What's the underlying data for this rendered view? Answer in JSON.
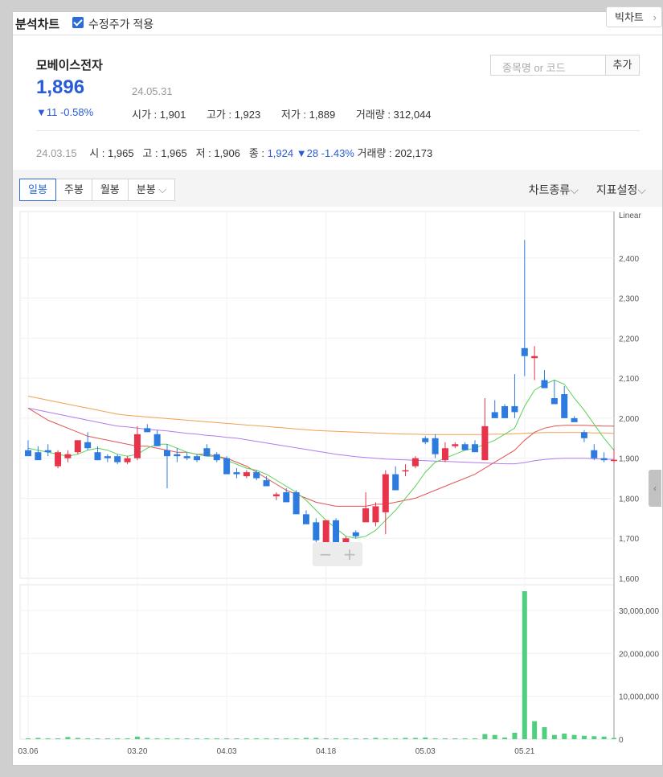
{
  "header": {
    "title": "분석차트",
    "adjusted_label": "수정주가 적용",
    "big_chart_label": "빅차트"
  },
  "stock": {
    "name": "모베이스전자",
    "price": "1,896",
    "date": "24.05.31",
    "change": "▼11 -0.58%",
    "open_label": "시가",
    "open": "1,901",
    "high_label": "고가",
    "high": "1,923",
    "low_label": "저가",
    "low": "1,889",
    "volume_label": "거래량",
    "volume": "312,044"
  },
  "search": {
    "placeholder": "종목명 or 코드",
    "add_label": "추가"
  },
  "prev_day": {
    "date": "24.03.15",
    "open": "시 : 1,965",
    "high": "고 : 1,965",
    "low": "저 : 1,906",
    "close_label": "종 :",
    "close": "1,924",
    "change": "▼28 -1.43%",
    "volume": "거래량 : 202,173"
  },
  "tabs": [
    "일봉",
    "주봉",
    "월봉",
    "분봉"
  ],
  "tools": [
    "차트종류",
    "지표설정"
  ],
  "colors": {
    "up": "#e8344a",
    "down": "#2e7be0",
    "volume": "#4fcf7f",
    "ma5": "#5ad05a",
    "ma20": "#e05555",
    "ma60": "#b07bf0",
    "ma120": "#f0a050",
    "accent": "#2a5bd6"
  },
  "chart_data": {
    "type": "candlestick",
    "scale": "Linear",
    "y_ticks": [
      2400,
      2300,
      2200,
      2100,
      2000,
      1900,
      1800,
      1700,
      1600
    ],
    "volume_ticks": [
      "30,000,000",
      "20,000,000",
      "10,000,000",
      "0"
    ],
    "x_labels": [
      "03.06",
      "03.20",
      "04.03",
      "04.18",
      "05.03",
      "05.21"
    ],
    "x_label_index": [
      0,
      11,
      20,
      30,
      40,
      50
    ],
    "candles": [
      [
        1920,
        1945,
        1910,
        1905
      ],
      [
        1915,
        1930,
        1900,
        1895
      ],
      [
        1920,
        1935,
        1905,
        1915
      ],
      [
        1880,
        1920,
        1875,
        1915
      ],
      [
        1900,
        1920,
        1890,
        1910
      ],
      [
        1915,
        1945,
        1910,
        1945
      ],
      [
        1940,
        1965,
        1920,
        1925
      ],
      [
        1915,
        1930,
        1895,
        1895
      ],
      [
        1905,
        1910,
        1890,
        1900
      ],
      [
        1905,
        1910,
        1885,
        1890
      ],
      [
        1890,
        1905,
        1885,
        1900
      ],
      [
        1900,
        1980,
        1895,
        1960
      ],
      [
        1975,
        1985,
        1965,
        1965
      ],
      [
        1960,
        1970,
        1940,
        1930
      ],
      [
        1920,
        1935,
        1825,
        1905
      ],
      [
        1910,
        1925,
        1890,
        1905
      ],
      [
        1905,
        1915,
        1895,
        1900
      ],
      [
        1905,
        1910,
        1890,
        1895
      ],
      [
        1925,
        1935,
        1910,
        1905
      ],
      [
        1910,
        1915,
        1890,
        1895
      ],
      [
        1900,
        1905,
        1860,
        1860
      ],
      [
        1865,
        1875,
        1850,
        1860
      ],
      [
        1855,
        1870,
        1850,
        1865
      ],
      [
        1865,
        1870,
        1845,
        1850
      ],
      [
        1845,
        1855,
        1830,
        1830
      ],
      [
        1805,
        1815,
        1795,
        1810
      ],
      [
        1815,
        1825,
        1795,
        1790
      ],
      [
        1815,
        1820,
        1780,
        1760
      ],
      [
        1760,
        1770,
        1740,
        1735
      ],
      [
        1740,
        1750,
        1690,
        1695
      ],
      [
        1690,
        1745,
        1690,
        1745
      ],
      [
        1745,
        1750,
        1685,
        1680
      ],
      [
        1690,
        1705,
        1680,
        1700
      ],
      [
        1715,
        1720,
        1700,
        1705
      ],
      [
        1740,
        1815,
        1740,
        1775
      ],
      [
        1740,
        1790,
        1730,
        1780
      ],
      [
        1765,
        1870,
        1710,
        1860
      ],
      [
        1860,
        1880,
        1850,
        1820
      ],
      [
        1870,
        1885,
        1855,
        1870
      ],
      [
        1880,
        1905,
        1875,
        1900
      ],
      [
        1950,
        1955,
        1935,
        1940
      ],
      [
        1950,
        1960,
        1900,
        1910
      ],
      [
        1895,
        1940,
        1890,
        1925
      ],
      [
        1930,
        1940,
        1925,
        1935
      ],
      [
        1935,
        1940,
        1920,
        1920
      ],
      [
        1935,
        1945,
        1920,
        1915
      ],
      [
        1895,
        2050,
        1895,
        1980
      ],
      [
        2015,
        2045,
        2005,
        2000
      ],
      [
        2030,
        2035,
        2005,
        2000
      ],
      [
        2030,
        2110,
        2000,
        2015
      ],
      [
        2175,
        2445,
        2105,
        2155
      ],
      [
        2150,
        2180,
        2095,
        2155
      ],
      [
        2095,
        2120,
        2075,
        2075
      ],
      [
        2050,
        2095,
        2040,
        2035
      ],
      [
        2060,
        2080,
        2000,
        2000
      ],
      [
        2000,
        2005,
        1995,
        1990
      ],
      [
        1965,
        1970,
        1940,
        1950
      ],
      [
        1920,
        1935,
        1895,
        1900
      ],
      [
        1900,
        1915,
        1890,
        1895
      ],
      [
        1896,
        1923,
        1889,
        1896
      ]
    ],
    "volume": [
      0.2,
      0.3,
      0.2,
      0.2,
      0.5,
      0.3,
      0.2,
      0.2,
      0.2,
      0.2,
      0.2,
      0.6,
      0.3,
      0.2,
      0.2,
      0.2,
      0.2,
      0.2,
      0.2,
      0.2,
      0.2,
      0.2,
      0.2,
      0.2,
      0.2,
      0.2,
      0.2,
      0.2,
      0.3,
      0.3,
      0.2,
      0.2,
      0.2,
      0.2,
      0.2,
      0.3,
      0.2,
      0.2,
      0.3,
      0.3,
      0.4,
      0.2,
      0.2,
      0.2,
      0.2,
      0.2,
      1.2,
      1.0,
      0.4,
      1.5,
      34.5,
      4.2,
      2.8,
      1.0,
      1.3,
      1.0,
      0.8,
      0.7,
      0.6,
      0.3
    ],
    "ma5": [
      1925,
      1920,
      1915,
      1910,
      1905,
      1910,
      1920,
      1925,
      1920,
      1910,
      1905,
      1910,
      1925,
      1935,
      1935,
      1925,
      1915,
      1910,
      1905,
      1905,
      1895,
      1885,
      1875,
      1870,
      1860,
      1845,
      1830,
      1815,
      1795,
      1770,
      1745,
      1725,
      1705,
      1700,
      1705,
      1720,
      1745,
      1770,
      1800,
      1830,
      1865,
      1890,
      1900,
      1910,
      1920,
      1925,
      1935,
      1945,
      1960,
      1975,
      2030,
      2070,
      2085,
      2095,
      2085,
      2050,
      2020,
      1985,
      1950,
      1920
    ],
    "ma20": [
      2025,
      2010,
      1995,
      1985,
      1975,
      1965,
      1955,
      1950,
      1945,
      1940,
      1935,
      1930,
      1930,
      1925,
      1920,
      1915,
      1915,
      1910,
      1910,
      1905,
      1900,
      1890,
      1880,
      1865,
      1850,
      1835,
      1820,
      1810,
      1800,
      1790,
      1785,
      1780,
      1780,
      1780,
      1780,
      1785,
      1785,
      1790,
      1795,
      1800,
      1810,
      1820,
      1830,
      1840,
      1850,
      1860,
      1875,
      1890,
      1905,
      1920,
      1945,
      1965,
      1975,
      1980,
      1982,
      1982,
      1982,
      1981,
      1980,
      1980
    ],
    "ma60": [
      2025,
      2020,
      2015,
      2010,
      2005,
      2000,
      1995,
      1990,
      1985,
      1980,
      1978,
      1975,
      1972,
      1970,
      1968,
      1965,
      1962,
      1960,
      1957,
      1955,
      1952,
      1950,
      1946,
      1942,
      1938,
      1934,
      1930,
      1926,
      1922,
      1918,
      1914,
      1910,
      1907,
      1904,
      1902,
      1900,
      1898,
      1897,
      1896,
      1895,
      1894,
      1893,
      1892,
      1891,
      1890,
      1889,
      1888,
      1887,
      1886,
      1886,
      1889,
      1894,
      1897,
      1899,
      1900,
      1900,
      1900,
      1899,
      1898,
      1897
    ],
    "ma120": [
      2055,
      2050,
      2045,
      2040,
      2035,
      2030,
      2025,
      2020,
      2015,
      2010,
      2007,
      2005,
      2003,
      2001,
      1999,
      1997,
      1995,
      1993,
      1991,
      1989,
      1987,
      1985,
      1983,
      1981,
      1979,
      1977,
      1975,
      1973,
      1971,
      1969,
      1968,
      1967,
      1966,
      1965,
      1964,
      1963,
      1962,
      1961,
      1960,
      1960,
      1959,
      1959,
      1959,
      1959,
      1959,
      1959,
      1959,
      1960,
      1960,
      1961,
      1962,
      1963,
      1964,
      1964,
      1964,
      1964,
      1964,
      1963,
      1963,
      1962
    ]
  },
  "zoom": {
    "minus": "−",
    "plus": "+"
  }
}
